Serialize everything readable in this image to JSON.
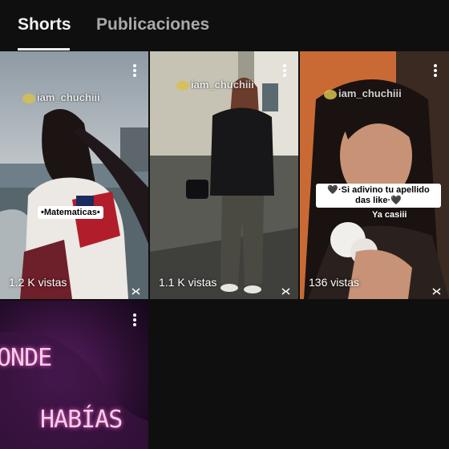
{
  "tabs": [
    {
      "label": "Shorts",
      "active": true
    },
    {
      "label": "Publicaciones",
      "active": false
    }
  ],
  "shorts": [
    {
      "views": "1.2 K vistas",
      "watermark": "iam_chuchiii",
      "overlay_text": "•Matematicas•"
    },
    {
      "views": "1.1 K vistas",
      "watermark": "iam_chuchiii"
    },
    {
      "views": "136 vistas",
      "watermark": "iam_chuchiii",
      "overlay_text": "🖤·Si adivino tu apellido das like·🖤",
      "overlay_text_2": "Ya casiii"
    },
    {
      "overlay_line_1": "ONDE",
      "overlay_line_2": "HABÍAS"
    }
  ],
  "icons": {
    "menu": "more-vert-icon",
    "capcut": "capcut-icon"
  },
  "colors": {
    "background": "#0f0f0f",
    "tab_active": "#f1f1f1",
    "tab_inactive": "#aaaaaa"
  }
}
